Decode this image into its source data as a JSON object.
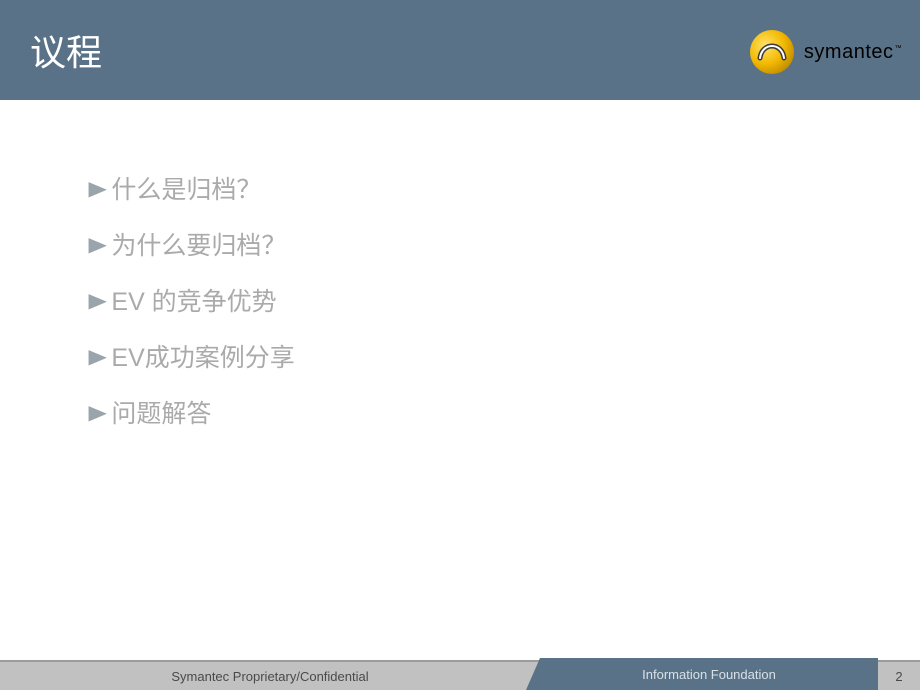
{
  "header": {
    "title": "议程",
    "brand": "symantec",
    "brand_tm": "™"
  },
  "agenda": {
    "items": [
      "什么是归档？",
      "为什么要归档？",
      "EV 的竞争优势",
      "EV成功案例分享",
      "问题解答"
    ]
  },
  "footer": {
    "left": "Symantec Proprietary/Confidential",
    "center": "Information Foundation",
    "page": "2"
  },
  "colors": {
    "header_bg": "#5a7288",
    "footer_bg": "#c1c1c1",
    "accent_yellow": "#f2b900"
  }
}
